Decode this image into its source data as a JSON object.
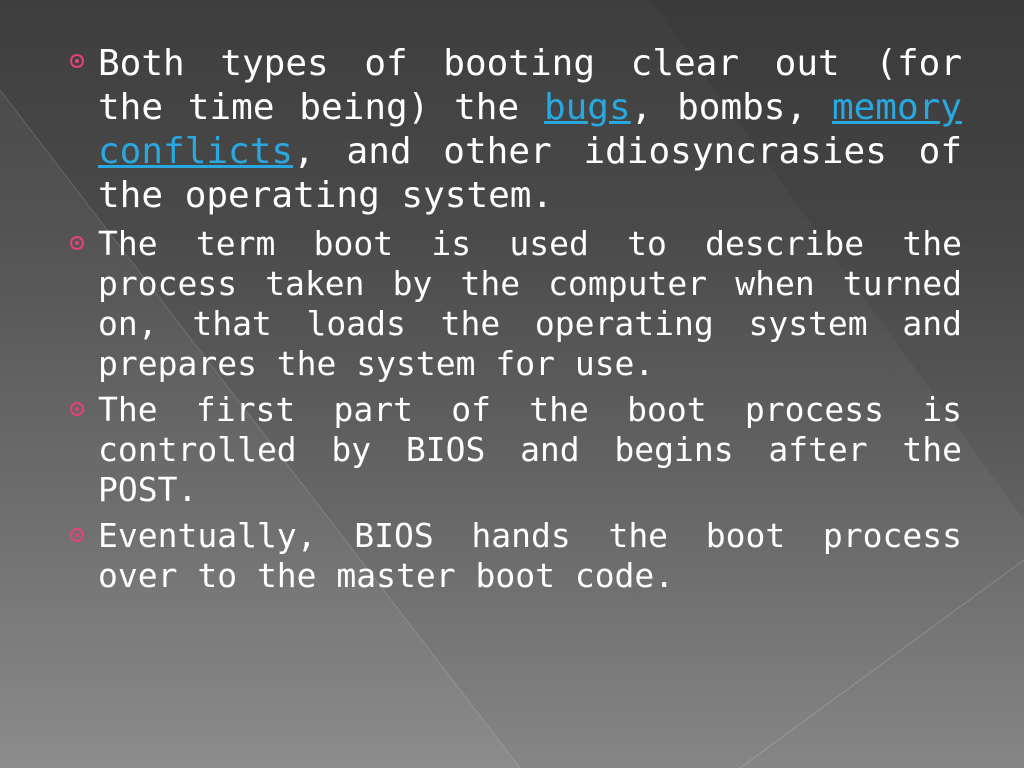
{
  "slide": {
    "bullets": [
      {
        "parts": [
          "Both types of booting clear out (for the time being) the ",
          {
            "link": "bugs"
          },
          ", bombs, ",
          {
            "link": "memory"
          },
          " ",
          {
            "link": "conflicts"
          },
          ", and other idiosyncrasies of the operating system."
        ]
      },
      {
        "text": "The term boot is used to describe the process taken by the computer when turned on, that loads the operating system and prepares the system for use."
      },
      {
        "text": "The first part of the boot process is controlled by BIOS and begins after the POST."
      },
      {
        "text": "Eventually, BIOS hands the boot process over to the master boot code."
      }
    ],
    "b0": {
      "t1": "Both types of booting clear out (for the time being) the ",
      "l1": "bugs",
      "t2": ", bombs, ",
      "l2": "memory",
      "t3": " ",
      "l3": "conflicts",
      "t4": ", and other idiosyncrasies of the operating system."
    },
    "colors": {
      "bullet": "#e8407a",
      "link": "#29a8e0",
      "text": "#ffffff"
    }
  }
}
